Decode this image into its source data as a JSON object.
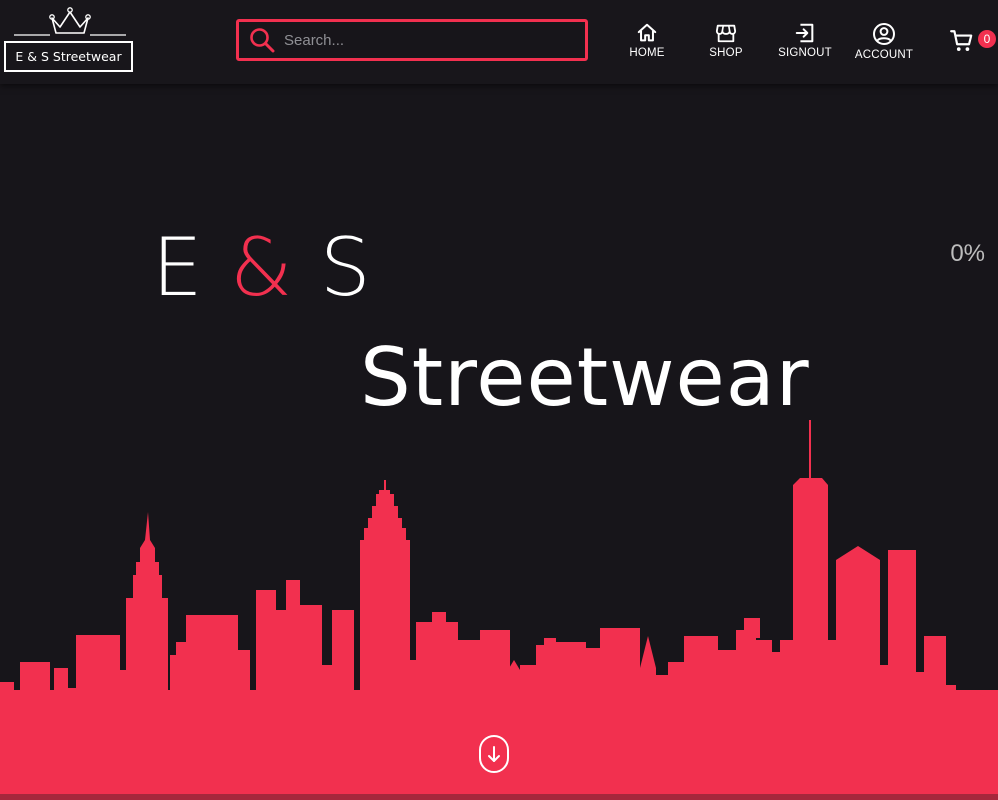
{
  "brand": {
    "logo_text": "E & S Streetwear"
  },
  "search": {
    "placeholder": "Search..."
  },
  "nav": {
    "items": [
      {
        "label": "HOME",
        "icon": "home-icon"
      },
      {
        "label": "SHOP",
        "icon": "shop-icon"
      },
      {
        "label": "SIGNOUT",
        "icon": "signout-icon"
      },
      {
        "label": "ACCOUNT",
        "icon": "account-icon"
      }
    ]
  },
  "cart": {
    "count": "0",
    "icon": "cart-icon"
  },
  "hero": {
    "title_part1": "E",
    "title_amp": "&",
    "title_part2": "S",
    "subtitle": "Streetwear",
    "progress": "0%"
  },
  "colors": {
    "background": "#17151a",
    "accent": "#f2304f",
    "text": "#ffffff"
  },
  "scroll_icon": "arrow-down-icon"
}
